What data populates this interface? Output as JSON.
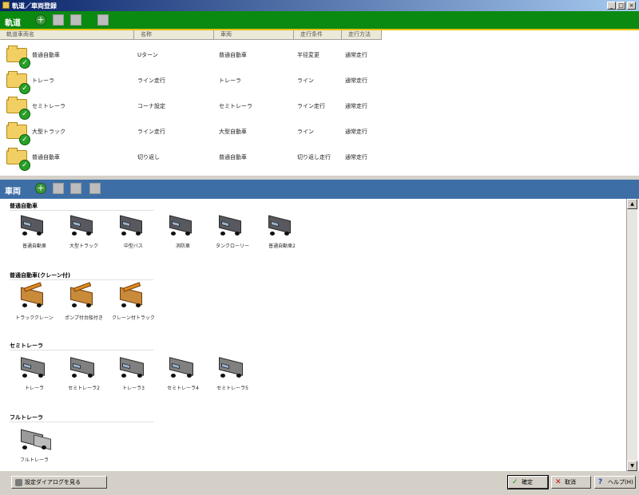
{
  "window": {
    "title": "軌道／車両登録"
  },
  "top_section": {
    "title": "軌道",
    "columns": [
      "軌道車両名",
      "名称",
      "車両",
      "走行条件",
      "走行方法"
    ],
    "rows": [
      {
        "name": "普通自動車",
        "label": "Uターン",
        "vehicle": "普通自動車",
        "cond": "半径変更",
        "method": "通常走行"
      },
      {
        "name": "トレーラ",
        "label": "ライン走行",
        "vehicle": "トレーラ",
        "cond": "ライン",
        "method": "通常走行"
      },
      {
        "name": "セミトレーラ",
        "label": "コーナ設定",
        "vehicle": "セミトレーラ",
        "cond": "ライン走行",
        "method": "通常走行"
      },
      {
        "name": "大型トラック",
        "label": "ライン走行",
        "vehicle": "大型自動車",
        "cond": "ライン",
        "method": "通常走行"
      },
      {
        "name": "普通自動車",
        "label": "切り返し",
        "vehicle": "普通自動車",
        "cond": "切り返し走行",
        "method": "通常走行"
      }
    ]
  },
  "bottom_section": {
    "title": "車両",
    "groups": [
      {
        "label": "普通自動車",
        "items": [
          "普通自動車",
          "大型トラック",
          "中型バス",
          "消防車",
          "タンクローリー",
          "普通自動車2"
        ]
      },
      {
        "label": "普通自動車(クレーン付)",
        "items": [
          "トラッククレーン",
          "ポンプ付台船付き",
          "クレーン付トラック"
        ]
      },
      {
        "label": "セミトレーラ",
        "items": [
          "トレーラ",
          "セミトレーラ2",
          "トレーラ3",
          "セミトレーラ4",
          "セミトレーラ5"
        ]
      },
      {
        "label": "フルトレーラ",
        "items": [
          "フルトレーラ"
        ]
      }
    ]
  },
  "footer": {
    "left_button": "設定ダイアログを見る",
    "ok": "確定",
    "cancel": "取消",
    "help": "ヘルプ(H)"
  },
  "colors": {
    "green_bar": "#0b8a12",
    "blue_bar": "#3d6fa6",
    "accent_line": "#e2c000"
  }
}
